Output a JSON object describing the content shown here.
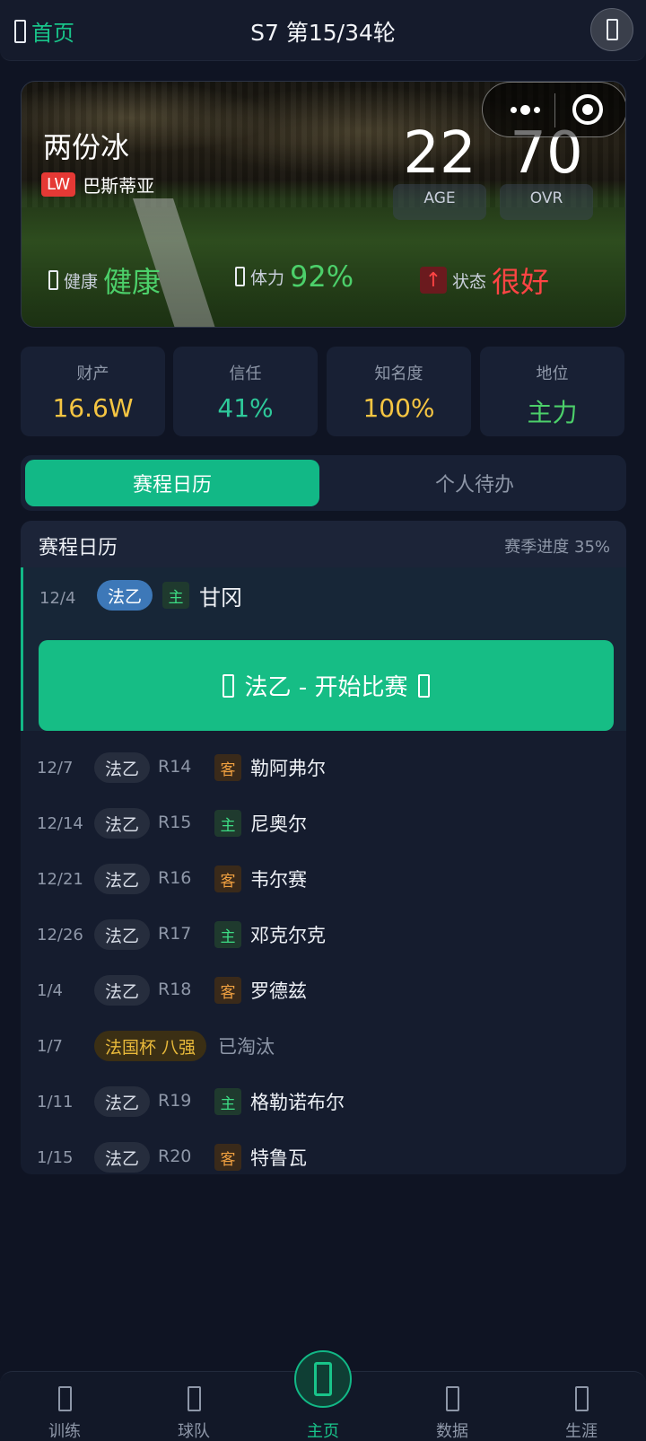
{
  "topbar": {
    "back_label": "首页",
    "title": "S7 第15/34轮"
  },
  "player": {
    "name": "两份冰",
    "position": "LW",
    "team": "巴斯蒂亚",
    "age": {
      "value": "22",
      "label": "AGE"
    },
    "ovr": {
      "value": "70",
      "label": "OVR"
    },
    "health": {
      "label": "健康",
      "value": "健康"
    },
    "stamina": {
      "label": "体力",
      "value": "92%"
    },
    "form": {
      "arrow": "↑",
      "label": "状态",
      "value": "很好"
    }
  },
  "attributes": [
    {
      "label": "财产",
      "value": "16.6W",
      "color": "#f5c542"
    },
    {
      "label": "信任",
      "value": "41%",
      "color": "#2ec99a"
    },
    {
      "label": "知名度",
      "value": "100%",
      "color": "#f5c542"
    },
    {
      "label": "地位",
      "value": "主力",
      "color": "#4cd06a"
    }
  ],
  "tabs": {
    "active": "赛程日历",
    "other": "个人待办"
  },
  "schedule": {
    "title": "赛程日历",
    "progress": "赛季进度 35%",
    "current": {
      "date": "12/4",
      "competition": "法乙",
      "venue": "主",
      "opponent": "甘冈",
      "button": "法乙 - 开始比赛"
    },
    "matches": [
      {
        "date": "12/7",
        "competition": "法乙",
        "round": "R14",
        "venue": "客",
        "opponent": "勒阿弗尔"
      },
      {
        "date": "12/14",
        "competition": "法乙",
        "round": "R15",
        "venue": "主",
        "opponent": "尼奥尔"
      },
      {
        "date": "12/21",
        "competition": "法乙",
        "round": "R16",
        "venue": "客",
        "opponent": "韦尔赛"
      },
      {
        "date": "12/26",
        "competition": "法乙",
        "round": "R17",
        "venue": "主",
        "opponent": "邓克尔克"
      },
      {
        "date": "1/4",
        "competition": "法乙",
        "round": "R18",
        "venue": "客",
        "opponent": "罗德兹"
      },
      {
        "date": "1/7",
        "competition": "法国杯 八强",
        "status": "已淘汰"
      },
      {
        "date": "1/11",
        "competition": "法乙",
        "round": "R19",
        "venue": "主",
        "opponent": "格勒诺布尔"
      },
      {
        "date": "1/15",
        "competition": "法乙",
        "round": "R20",
        "venue": "客",
        "opponent": "特鲁瓦"
      }
    ]
  },
  "nav": [
    {
      "label": "训练",
      "icon": "training-icon"
    },
    {
      "label": "球队",
      "icon": "team-icon"
    },
    {
      "label": "主页",
      "icon": "home-icon",
      "active": true
    },
    {
      "label": "数据",
      "icon": "data-icon"
    },
    {
      "label": "生涯",
      "icon": "career-icon"
    }
  ],
  "colors": {
    "accent": "#12b886",
    "health": "#4cd06a",
    "stamina": "#4cd06a",
    "form": "#ff4444"
  }
}
